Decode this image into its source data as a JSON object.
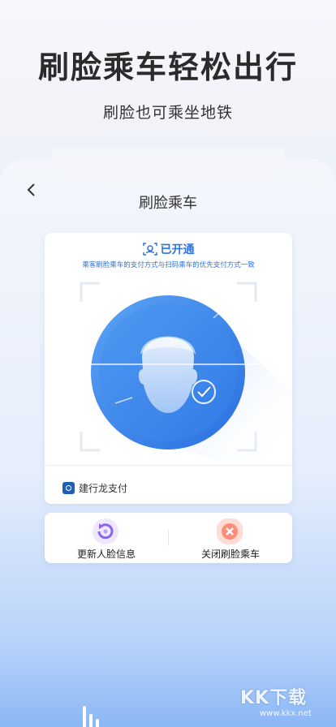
{
  "header": {
    "headline": "刷脸乘车轻松出行",
    "subline": "刷脸也可乘坐地铁"
  },
  "screen": {
    "title": "刷脸乘车",
    "status": "已开通",
    "hint": "乘客刷脸乘车的支付方式与扫码乘车的优先支付方式一致",
    "payment_method": "建行龙支付"
  },
  "actions": {
    "update_label": "更新人脸信息",
    "close_label": "关闭刷脸乘车"
  },
  "watermark": {
    "text": "KK下载",
    "url": "www.kkx.net"
  },
  "icons": {
    "back": "chevron-left-icon",
    "status": "face-id-icon",
    "face": "face-scan-icon",
    "bank": "ccb-logo-icon",
    "update": "refresh-icon",
    "close": "close-circle-icon"
  },
  "colors": {
    "accent": "#2f74e0",
    "scan_blue": "#3a86ec",
    "close_pink": "#ff7e6e",
    "update_purple": "#8a63f0"
  }
}
